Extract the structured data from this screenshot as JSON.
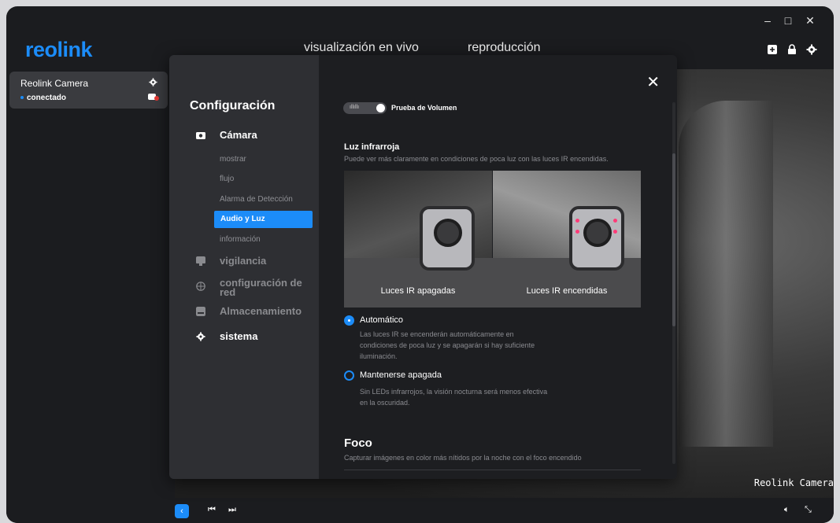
{
  "app": {
    "logo": "reolink",
    "nav": {
      "live": "visualización en vivo",
      "playback": "reproducción"
    },
    "window_controls": {
      "minimize": "–",
      "maximize": "□",
      "close": "✕"
    }
  },
  "sidebar": {
    "camera_name": "Reolink Camera",
    "camera_status": "conectado"
  },
  "video": {
    "watermark": "Reolink Camera"
  },
  "settings": {
    "title": "Configuración",
    "close": "✕",
    "menu": {
      "camera": "Cámara",
      "sub": [
        "mostrar",
        "flujo",
        "Alarma de Detección",
        "Audio y Luz",
        "información"
      ],
      "active_sub": "Audio y Luz",
      "surveillance": "vigilancia",
      "network": "configuración de red",
      "storage": "Almacenamiento",
      "system": "sistema"
    },
    "volume_test": "Prueba de Volumen",
    "ir": {
      "title": "Luz infrarroja",
      "desc": "Puede ver más claramente en condiciones de poca luz con las luces IR encendidas.",
      "label_off": "Luces IR apagadas",
      "label_on": "Luces IR encendidas",
      "option_auto": {
        "title": "Automático",
        "desc": "Las luces IR se encenderán automáticamente en condiciones de poca luz y se apagarán si hay suficiente iluminación.",
        "selected": true
      },
      "option_off": {
        "title": "Mantenerse apagada",
        "desc": "Sin LEDs infrarrojos, la visión nocturna será menos efectiva en la oscuridad.",
        "selected": false
      }
    },
    "foco": {
      "title": "Foco",
      "desc": "Capturar imágenes en color más nítidos por la noche con el foco encendido"
    }
  },
  "colors": {
    "accent": "#1c8cf8",
    "panel_left": "#2e2f33",
    "panel_right": "#1d1e21"
  }
}
